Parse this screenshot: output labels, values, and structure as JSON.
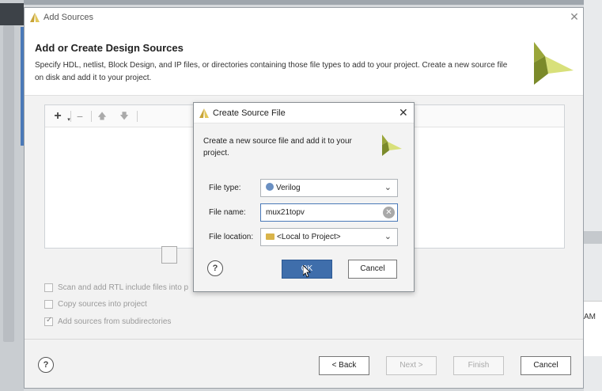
{
  "main_dialog": {
    "title": "Add Sources",
    "header_title": "Add or Create Design Sources",
    "header_desc": "Specify HDL, netlist, Block Design, and IP files, or directories containing those file types to add to your project. Create a new source file on disk and add it to your project.",
    "options": [
      {
        "label": "Scan and add RTL include files into p",
        "checked": false
      },
      {
        "label": "Copy sources into project",
        "checked": false
      },
      {
        "label": "Add sources from subdirectories",
        "checked": true
      }
    ],
    "footer": {
      "help": "?",
      "back": "< Back",
      "next": "Next >",
      "finish": "Finish",
      "cancel": "Cancel"
    }
  },
  "create_dialog": {
    "title": "Create Source File",
    "description": "Create a new source file and add it to your project.",
    "file_type_label": "File type:",
    "file_type_value": "Verilog",
    "file_name_label": "File name:",
    "file_name_value": "mux21topv",
    "file_location_label": "File location:",
    "file_location_value": "<Local to Project>",
    "help": "?",
    "ok": "OK",
    "cancel": "Cancel"
  },
  "background": {
    "right_fragment": "AM"
  },
  "colors": {
    "accent": "#3f6eab",
    "logo_green": "#9aa63a",
    "logo_light": "#d8e07a"
  }
}
